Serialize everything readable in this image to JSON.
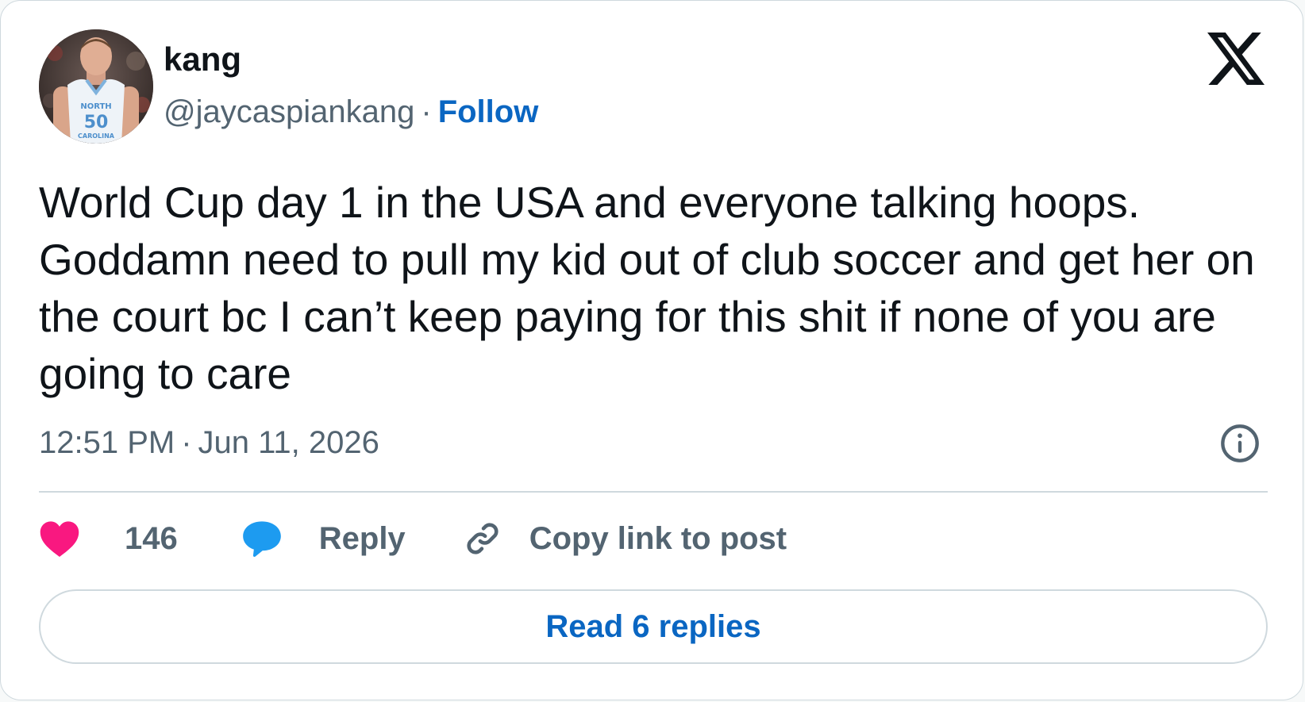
{
  "author": {
    "display_name": "kang",
    "handle": "@jaycaspiankang",
    "separator": "·",
    "follow_label": "Follow",
    "avatar_icon": "basketball-player-avatar",
    "jersey_text": "NORTH",
    "jersey_number": "50",
    "jersey_bottom_text": "CAROLINA"
  },
  "platform": {
    "logo_icon": "x-logo-icon"
  },
  "tweet": {
    "text": "World Cup day 1 in the USA and everyone talking hoops. Goddamn need to pull my kid out of club soccer and get her on the court bc I can’t keep paying for this shit if none of you are going to care",
    "time": "12:51 PM",
    "separator": "·",
    "date": "Jun 11, 2026"
  },
  "actions": {
    "like_count": "146",
    "reply_label": "Reply",
    "copy_link_label": "Copy link to post"
  },
  "read_replies_label": "Read 6 replies",
  "colors": {
    "text_primary": "#0f1419",
    "text_secondary": "#536471",
    "link_blue": "#0a66c2",
    "like_pink": "#f91880",
    "reply_blue": "#1d9bf0",
    "border": "#cfd9de"
  }
}
